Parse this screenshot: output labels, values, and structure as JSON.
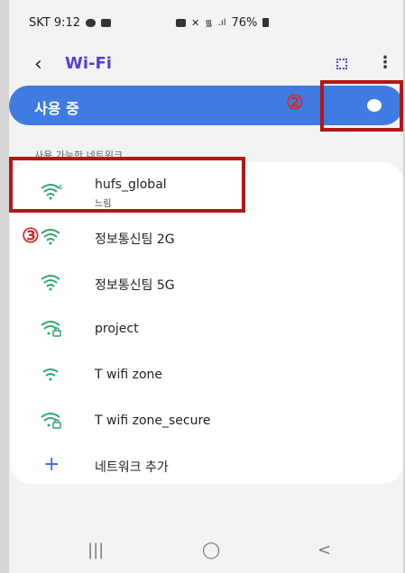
{
  "status_bar": {
    "carrier_time": "SKT 9:12",
    "battery": "76%"
  },
  "header": {
    "back_icon": "‹",
    "title": "Wi-Fi"
  },
  "toggle": {
    "label": "사용 중",
    "state": "on"
  },
  "annotations": {
    "marker_toggle": "②",
    "marker_network": "③"
  },
  "section_label": "사용 가능한 네트워크",
  "networks": [
    {
      "name": "hufs_global",
      "sub": "느림",
      "icon": "wifi-6-icon",
      "locked": false
    },
    {
      "name": "정보통신팀 2G",
      "icon": "wifi-icon",
      "locked": false
    },
    {
      "name": "정보통신팀 5G",
      "icon": "wifi-icon",
      "locked": false
    },
    {
      "name": "project",
      "icon": "wifi-lock-icon",
      "locked": true
    },
    {
      "name": "T wifi zone",
      "icon": "wifi-icon",
      "locked": false
    },
    {
      "name": "T wifi zone_secure",
      "icon": "wifi-lock-icon",
      "locked": true
    }
  ],
  "add_network": {
    "icon": "+",
    "label": "네트워크 추가"
  },
  "navbar": {
    "recents": "|||",
    "home": "◯",
    "back": "<"
  },
  "colors": {
    "accent": "#5a3fd0",
    "toggle_bar": "#3f7be0",
    "wifi_green": "#2fa86e",
    "annotation_red": "#b01818"
  }
}
